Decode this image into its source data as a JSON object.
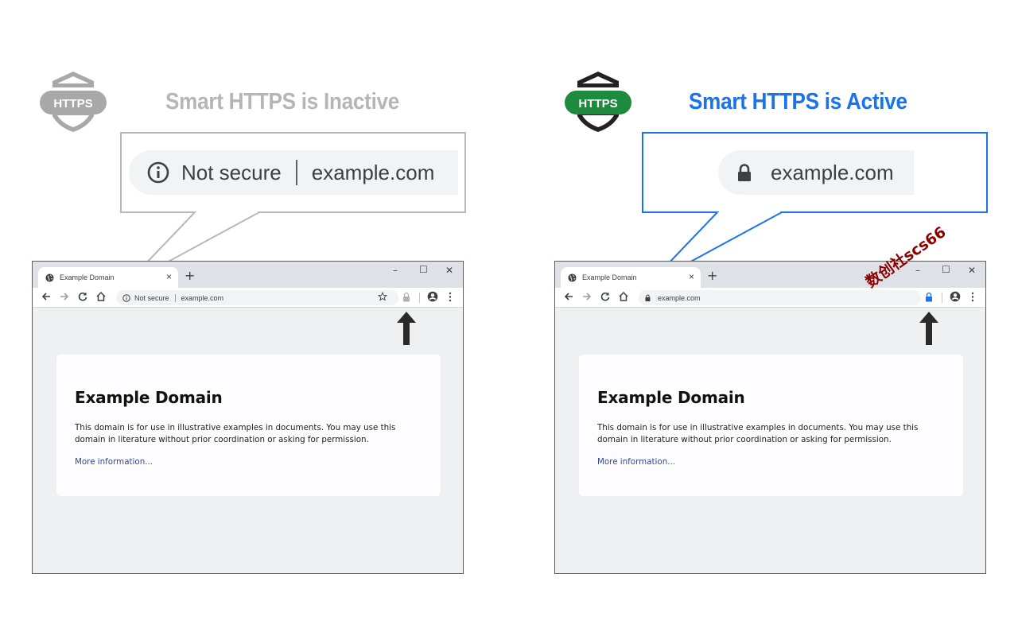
{
  "inactive": {
    "heading": "Smart HTTPS is Inactive",
    "badge_text": "HTTPS",
    "badge_color": "#a8a8a8",
    "callout_color": "#b8b8b8",
    "zoom": {
      "security_label": "Not secure",
      "url": "example.com"
    },
    "browser": {
      "tab_title": "Example Domain",
      "tab_close": "×",
      "new_tab": "+",
      "win_min": "–",
      "win_max": "☐",
      "win_close": "✕",
      "security_label": "Not secure",
      "url": "example.com"
    }
  },
  "active": {
    "heading": "Smart HTTPS is Active",
    "badge_text": "HTTPS",
    "badge_color": "#1e8a3e",
    "callout_color": "#1a73e8",
    "zoom": {
      "url": "example.com"
    },
    "browser": {
      "tab_title": "Example Domain",
      "tab_close": "×",
      "new_tab": "+",
      "win_min": "–",
      "win_max": "☐",
      "win_close": "✕",
      "url": "example.com"
    }
  },
  "page": {
    "title": "Example Domain",
    "body": "This domain is for use in illustrative examples in documents. You may use this domain in literature without prior coordination or asking for permission.",
    "link": "More information..."
  },
  "watermark": "数创社scs66",
  "icons": [
    "https-shield-icon",
    "info-icon",
    "lock-icon",
    "globe-icon",
    "back-icon",
    "forward-icon",
    "reload-icon",
    "home-icon",
    "star-icon",
    "profile-icon",
    "menu-icon",
    "arrow-up-icon"
  ]
}
